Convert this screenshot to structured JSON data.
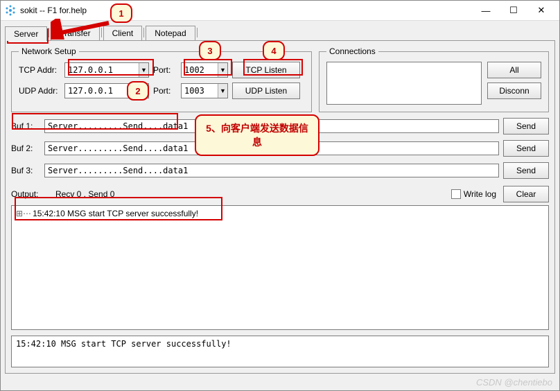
{
  "window": {
    "title": "sokit -- F1 for.help"
  },
  "tabs": {
    "server": "Server",
    "transfer": "Transfer",
    "client": "Client",
    "notepad": "Notepad"
  },
  "network": {
    "legend": "Network Setup",
    "tcp_addr_label": "TCP Addr:",
    "tcp_addr_value": "127.0.0.1",
    "tcp_port_label": "Port:",
    "tcp_port_value": "1002",
    "tcp_listen": "TCP Listen",
    "udp_addr_label": "UDP Addr:",
    "udp_addr_value": "127.0.0.1",
    "udp_port_label": "Port:",
    "udp_port_value": "1003",
    "udp_listen": "UDP Listen"
  },
  "connections": {
    "legend": "Connections",
    "all": "All",
    "disconn": "Disconn"
  },
  "bufs": {
    "b1_label": "Buf 1:",
    "b1_value": "Server.........Send....data1",
    "b2_label": "Buf 2:",
    "b2_value": "Server.........Send....data1",
    "b3_label": "Buf 3:",
    "b3_value": "Server.........Send....data1",
    "send": "Send"
  },
  "output": {
    "label": "Output:",
    "stats": "Recv 0 , Send 0",
    "write_log": "Write log",
    "clear": "Clear",
    "log_line": "15:42:10 MSG start TCP server successfully!",
    "status_line": "15:42:10 MSG start TCP server successfully!"
  },
  "annotations": {
    "n1": "1",
    "n2": "2",
    "n3": "3",
    "n4": "4",
    "msg": "5、向客户端发送数据信息"
  },
  "watermark": "CSDN @chentiebo"
}
